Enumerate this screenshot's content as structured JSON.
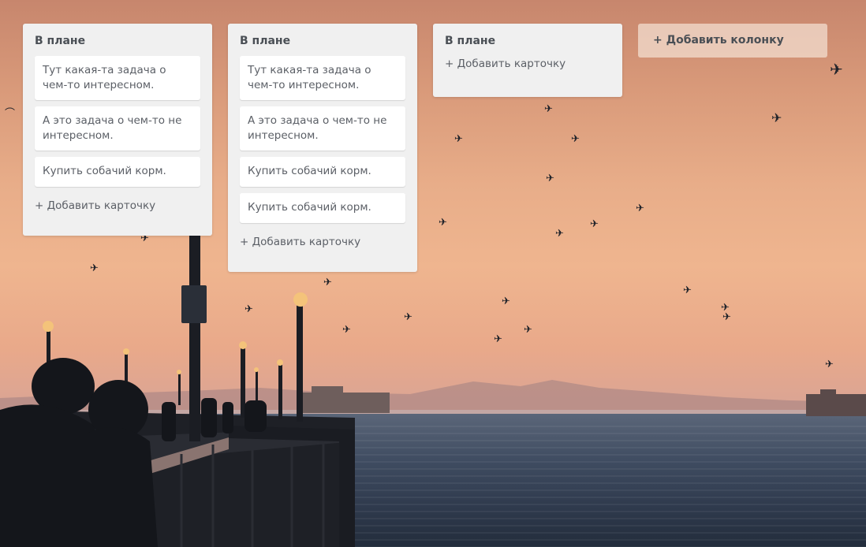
{
  "columns": [
    {
      "title": "В плане",
      "cards": [
        "Тут какая-та задача о чем-то интересном.",
        "А это задача о чем-то не интересном.",
        "Купить собачий корм."
      ],
      "add_card_label": "+ Добавить карточку"
    },
    {
      "title": "В плане",
      "cards": [
        "Тут какая-та задача о чем-то интересном.",
        "А это задача о чем-то не интересном.",
        "Купить собачий корм.",
        "Купить собачий корм."
      ],
      "add_card_label": "+ Добавить карточку"
    },
    {
      "title": "В плане",
      "cards": [],
      "add_card_label": "+ Добавить карточку"
    }
  ],
  "add_column_label": "+ Добавить колонку"
}
